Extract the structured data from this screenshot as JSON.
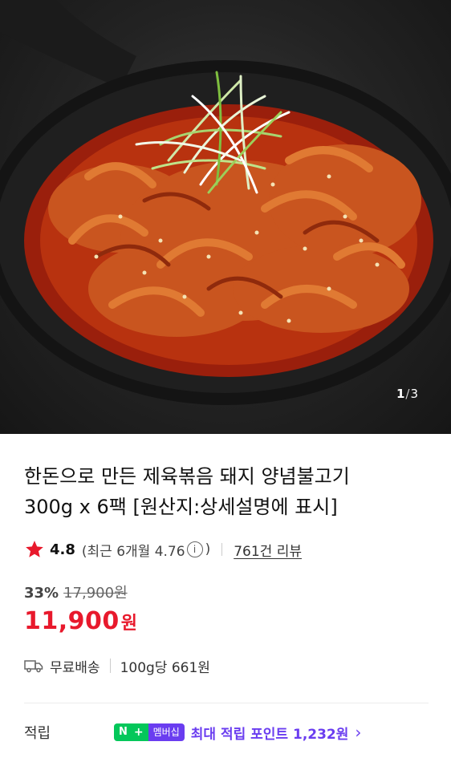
{
  "gallery": {
    "current": "1",
    "separator": "/",
    "total": "3",
    "image_alt": "제육볶음 무쇠팬 사진"
  },
  "product": {
    "title_line1": "한돈으로 만든 제육볶음 돼지 양념불고기",
    "title_line2": "300g x 6팩 [원산지:상세설명에 표시]"
  },
  "rating": {
    "score": "4.8",
    "recent_text": "(최근 6개월 4.76",
    "recent_close": ")",
    "info_icon": "i",
    "reviews_link": "761건 리뷰"
  },
  "price": {
    "discount": "33%",
    "original": "17,900원",
    "sale_number": "11,900",
    "sale_unit": "원"
  },
  "shipping": {
    "free": "무료배송",
    "unit_price": "100g당 661원"
  },
  "points": {
    "label": "적립",
    "badge_n": "N",
    "badge_plus": "+",
    "badge_member": "멤버십",
    "text": "최대 적립 포인트 1,232원",
    "chevron": "›"
  },
  "colors": {
    "sale_red": "#e8192c",
    "naver_green": "#03c75a",
    "membership_purple": "#6a3df0"
  }
}
